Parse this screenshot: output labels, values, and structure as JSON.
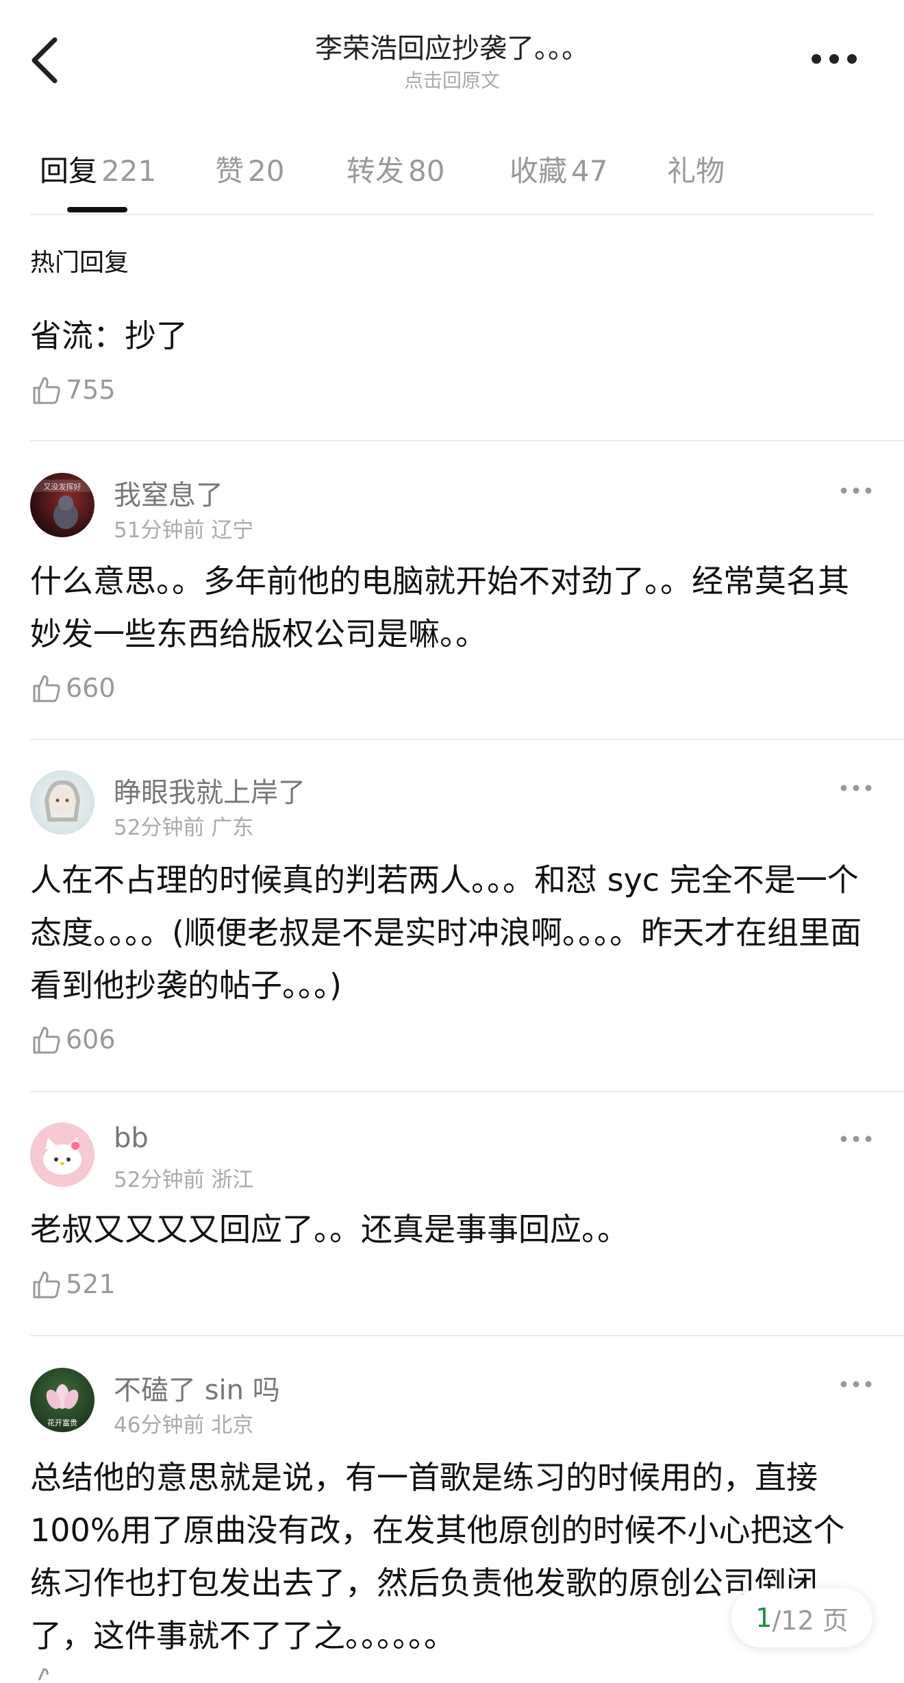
{
  "header": {
    "title": "李荣浩回应抄袭了。。。",
    "subtitle": "点击回原文",
    "back_icon": "back-chevron-icon",
    "more_icon": "more-dots-icon"
  },
  "tabs": [
    {
      "label": "回复",
      "count": "221",
      "active": true
    },
    {
      "label": "赞",
      "count": "20",
      "active": false
    },
    {
      "label": "转发",
      "count": "80",
      "active": false
    },
    {
      "label": "收藏",
      "count": "47",
      "active": false
    },
    {
      "label": "礼物",
      "count": "",
      "active": false
    }
  ],
  "hot": {
    "section_label": "热门回复",
    "text": "省流：抄了",
    "likes": "755"
  },
  "comments": [
    {
      "user": "我窒息了",
      "time": "51分钟前",
      "location": "辽宁",
      "text": "什么意思。。多年前他的电脑就开始不对劲了。。经常莫名其妙发一些东西给版权公司是嘛。。",
      "likes": "660",
      "avatar_text": "又没发挥好"
    },
    {
      "user": "睁眼我就上岸了",
      "time": "52分钟前",
      "location": "广东",
      "text": "人在不占理的时候真的判若两人。。。和怼 syc 完全不是一个态度。。。。(顺便老叔是不是实时冲浪啊。。。。昨天才在组里面看到他抄袭的帖子。。。)",
      "likes": "606"
    },
    {
      "user": "bb",
      "time": "52分钟前",
      "location": "浙江",
      "text": "老叔又又又又回应了。。还真是事事回应。。",
      "likes": "521"
    },
    {
      "user": "不磕了 sin 吗",
      "time": "46分钟前",
      "location": "北京",
      "text": "总结他的意思就是说，有一首歌是练习的时候用的，直接100%用了原曲没有改，在发其他原创的时候不小心把这个练习作也打包发出去了，然后负责他发歌的原创公司倒闭了，这件事就不了了之。。。。。。",
      "likes": "",
      "avatar_text": "花开富贵"
    }
  ],
  "pager": {
    "current": "1",
    "total": "/12 页"
  },
  "colors": {
    "accent_green": "#1a8f3c",
    "divider": "#ededed",
    "text_main": "#111111",
    "text_muted": "#999999"
  }
}
